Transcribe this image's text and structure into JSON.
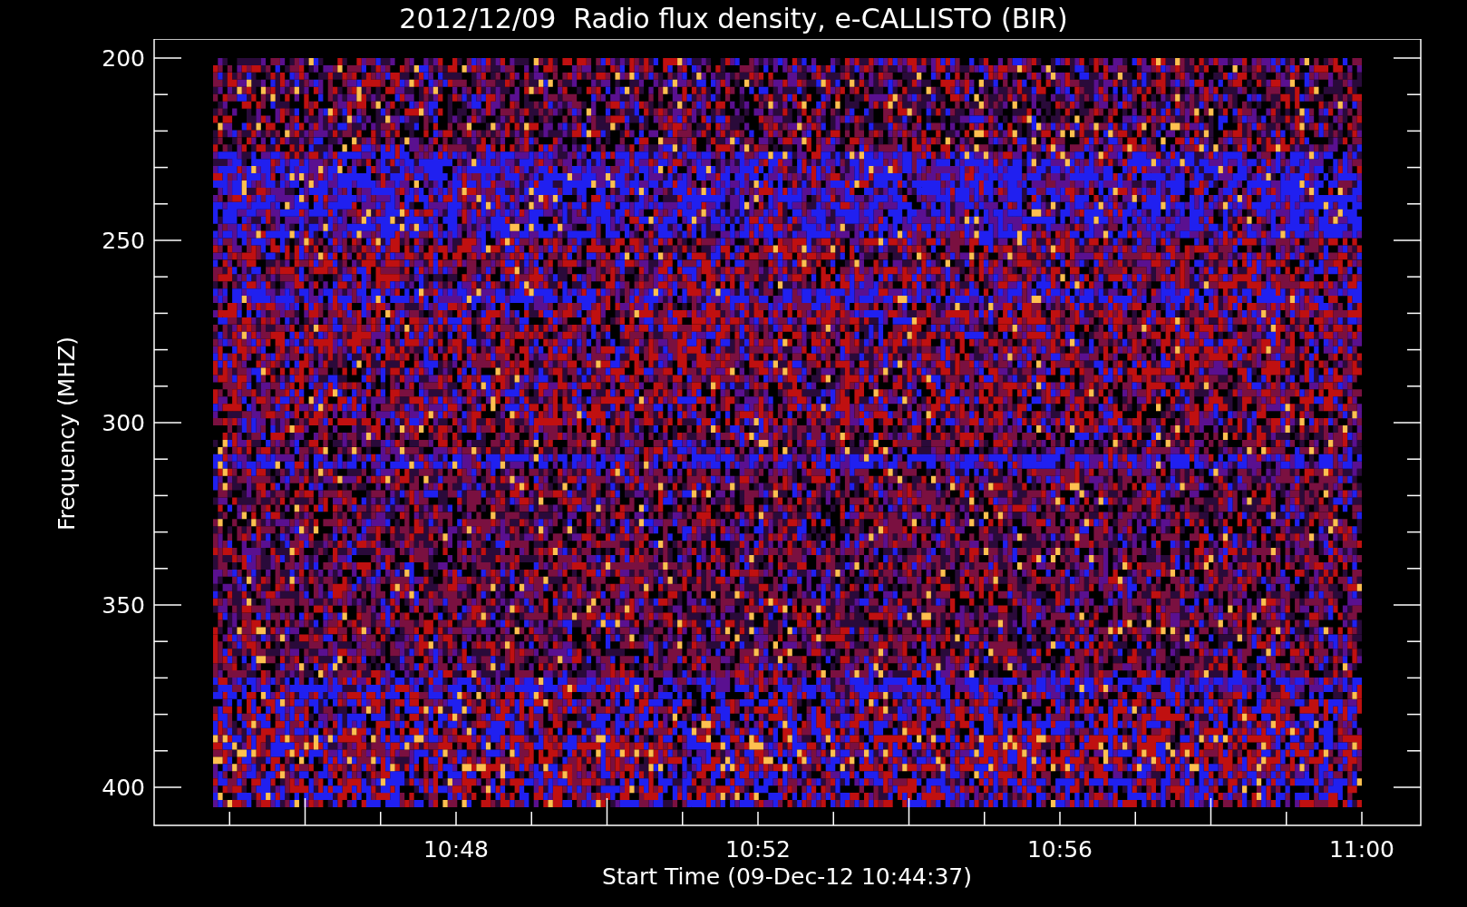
{
  "title": "2012/12/09  Radio flux density, e-CALLISTO (BIR)",
  "plot": {
    "ylabel": "Frequency (MHZ)",
    "xlabel": "Start Time (09-Dec-12 10:44:37)",
    "yticks": [
      "200",
      "250",
      "300",
      "350",
      "400"
    ],
    "xticks": [
      "10:48",
      "10:52",
      "10:56",
      "11:00"
    ]
  }
}
